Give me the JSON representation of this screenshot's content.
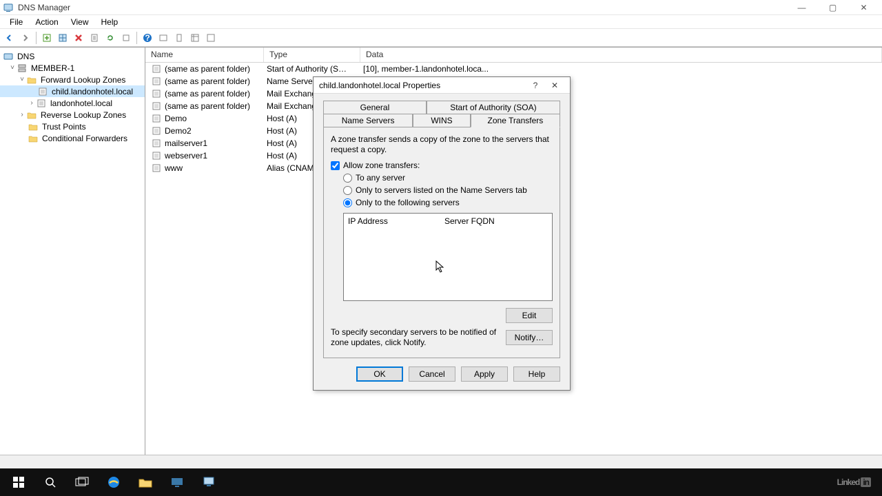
{
  "window": {
    "title": "DNS Manager",
    "minimize": "—",
    "maximize": "▢",
    "close": "✕"
  },
  "menu": {
    "file": "File",
    "action": "Action",
    "view": "View",
    "help": "Help"
  },
  "tree": {
    "root": "DNS",
    "server": "MEMBER-1",
    "flz": "Forward Lookup Zones",
    "child": "child.landonhotel.local",
    "landon": "landonhotel.local",
    "rlz": "Reverse Lookup Zones",
    "trust": "Trust Points",
    "cond": "Conditional Forwarders"
  },
  "list": {
    "headers": {
      "name": "Name",
      "type": "Type",
      "data": "Data"
    },
    "rows": [
      {
        "name": "(same as parent folder)",
        "type": "Start of Authority (SOA)",
        "data": "[10], member-1.landonhotel.loca..."
      },
      {
        "name": "(same as parent folder)",
        "type": "Name Server",
        "data": ""
      },
      {
        "name": "(same as parent folder)",
        "type": "Mail Exchange",
        "data": ""
      },
      {
        "name": "(same as parent folder)",
        "type": "Mail Exchange",
        "data": ""
      },
      {
        "name": "Demo",
        "type": "Host (A)",
        "data": ""
      },
      {
        "name": "Demo2",
        "type": "Host (A)",
        "data": ""
      },
      {
        "name": "mailserver1",
        "type": "Host (A)",
        "data": ""
      },
      {
        "name": "webserver1",
        "type": "Host (A)",
        "data": ""
      },
      {
        "name": "www",
        "type": "Alias (CNAME",
        "data": ""
      }
    ]
  },
  "dialog": {
    "title": "child.landonhotel.local Properties",
    "help": "?",
    "close": "✕",
    "tabs": {
      "general": "General",
      "soa": "Start of Authority (SOA)",
      "ns": "Name Servers",
      "wins": "WINS",
      "zt": "Zone Transfers"
    },
    "desc": "A zone transfer sends a copy of the zone to the servers that request a copy.",
    "allow": "Allow zone transfers:",
    "radio_any": "To any server",
    "radio_ns": "Only to servers listed on the Name Servers tab",
    "radio_following": "Only to the following servers",
    "col_ip": "IP Address",
    "col_fqdn": "Server FQDN",
    "edit": "Edit",
    "notify_text": "To specify secondary servers to be notified of zone updates, click Notify.",
    "notify": "Notify…",
    "ok": "OK",
    "cancel": "Cancel",
    "apply": "Apply",
    "help_btn": "Help"
  },
  "linkedin": {
    "text": "Linked",
    "box": "in"
  }
}
